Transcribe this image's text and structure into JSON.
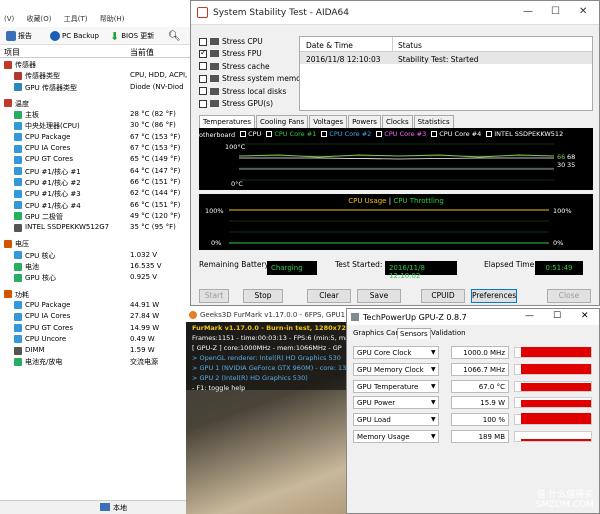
{
  "left": {
    "menu": [
      "(V)",
      "收藏(O)",
      "工具(T)",
      "帮助(H)"
    ],
    "toolbar": {
      "report": "报告",
      "backup": "PC Backup",
      "bios": "BIOS 更新"
    },
    "col_item": "项目",
    "col_value": "当前值",
    "rows": [
      {
        "type": "cat",
        "label": "传感器",
        "value": "",
        "color": "#c0392b",
        "indent": 4
      },
      {
        "type": "item",
        "label": "传感器类型",
        "value": "CPU, HDD, ACPI,",
        "color": "#b03a2e",
        "indent": 14
      },
      {
        "type": "item",
        "label": "GPU 传感器类型",
        "value": "Diode (NV-Diod",
        "color": "#2e86c1",
        "indent": 14
      },
      {
        "type": "gap"
      },
      {
        "type": "cat",
        "label": "温度",
        "value": "",
        "color": "#c0392b",
        "indent": 4
      },
      {
        "type": "item",
        "label": "主板",
        "value": "28 °C (82 °F)",
        "color": "#27ae60",
        "indent": 14
      },
      {
        "type": "item",
        "label": "中央处理器(CPU)",
        "value": "30 °C (86 °F)",
        "color": "#3498db",
        "indent": 14
      },
      {
        "type": "item",
        "label": "CPU Package",
        "value": "67 °C (153 °F)",
        "color": "#3498db",
        "indent": 14
      },
      {
        "type": "item",
        "label": "CPU IA Cores",
        "value": "67 °C (153 °F)",
        "color": "#3498db",
        "indent": 14
      },
      {
        "type": "item",
        "label": "CPU GT Cores",
        "value": "65 °C (149 °F)",
        "color": "#3498db",
        "indent": 14
      },
      {
        "type": "item",
        "label": "CPU #1/核心 #1",
        "value": "64 °C (147 °F)",
        "color": "#3498db",
        "indent": 14
      },
      {
        "type": "item",
        "label": "CPU #1/核心 #2",
        "value": "66 °C (151 °F)",
        "color": "#3498db",
        "indent": 14
      },
      {
        "type": "item",
        "label": "CPU #1/核心 #3",
        "value": "62 °C (144 °F)",
        "color": "#3498db",
        "indent": 14
      },
      {
        "type": "item",
        "label": "CPU #1/核心 #4",
        "value": "66 °C (151 °F)",
        "color": "#3498db",
        "indent": 14
      },
      {
        "type": "item",
        "label": "GPU 二极管",
        "value": "49 °C (120 °F)",
        "color": "#27ae60",
        "indent": 14
      },
      {
        "type": "item",
        "label": "INTEL SSDPEKKW512G7",
        "value": "35 °C (95 °F)",
        "color": "#555555",
        "indent": 14
      },
      {
        "type": "gap"
      },
      {
        "type": "cat",
        "label": "电压",
        "value": "",
        "color": "#d35400",
        "indent": 4
      },
      {
        "type": "item",
        "label": "CPU 核心",
        "value": "1.032 V",
        "color": "#3498db",
        "indent": 14
      },
      {
        "type": "item",
        "label": "电池",
        "value": "16.535 V",
        "color": "#27ae60",
        "indent": 14
      },
      {
        "type": "item",
        "label": "GPU 核心",
        "value": "0.925 V",
        "color": "#27ae60",
        "indent": 14
      },
      {
        "type": "gap"
      },
      {
        "type": "cat",
        "label": "功耗",
        "value": "",
        "color": "#d35400",
        "indent": 4
      },
      {
        "type": "item",
        "label": "CPU Package",
        "value": "44.91 W",
        "color": "#3498db",
        "indent": 14
      },
      {
        "type": "item",
        "label": "CPU IA Cores",
        "value": "27.84 W",
        "color": "#3498db",
        "indent": 14
      },
      {
        "type": "item",
        "label": "CPU GT Cores",
        "value": "14.99 W",
        "color": "#3498db",
        "indent": 14
      },
      {
        "type": "item",
        "label": "CPU Uncore",
        "value": "0.49 W",
        "color": "#3498db",
        "indent": 14
      },
      {
        "type": "item",
        "label": "DIMM",
        "value": "1.59 W",
        "color": "#555555",
        "indent": 14
      },
      {
        "type": "item",
        "label": "电池充/放电",
        "value": "交流电源",
        "color": "#27ae60",
        "indent": 14
      }
    ],
    "status": "本地"
  },
  "stab": {
    "title": "System Stability Test - AIDA64",
    "stress": [
      {
        "label": "Stress CPU",
        "checked": false
      },
      {
        "label": "Stress FPU",
        "checked": true
      },
      {
        "label": "Stress cache",
        "checked": false
      },
      {
        "label": "Stress system memory",
        "checked": false
      },
      {
        "label": "Stress local disks",
        "checked": false
      },
      {
        "label": "Stress GPU(s)",
        "checked": false
      }
    ],
    "ev_col1": "Date & Time",
    "ev_col2": "Status",
    "ev_time": "2016/11/8 12:10:03",
    "ev_status": "Stability Test: Started",
    "tabs": [
      "Temperatures",
      "Cooling Fans",
      "Voltages",
      "Powers",
      "Clocks",
      "Statistics"
    ],
    "legend": [
      {
        "label": "otherboard",
        "color": "#ffffff"
      },
      {
        "label": "CPU",
        "color": "#ffffff"
      },
      {
        "label": "CPU Core #1",
        "color": "#2ecc40"
      },
      {
        "label": "CPU Core #2",
        "color": "#3fa9f5"
      },
      {
        "label": "CPU Core #3",
        "color": "#ff66ff"
      },
      {
        "label": "CPU Core #4",
        "color": "#ffffff"
      },
      {
        "label": "INTEL SSDPEKKW512",
        "color": "#ffffff"
      }
    ],
    "temp_top": "100°C",
    "temp_bot": "0°C",
    "temp_r1": "66",
    "temp_r1b": "68",
    "temp_r2": "30",
    "temp_r2b": "35",
    "usage_title": "CPU Usage",
    "usage_sep": "|",
    "throttle_title": "CPU Throttling",
    "pct100": "100%",
    "pct0": "0%",
    "pct100r": "100%",
    "pct0r": "0%",
    "battery_label": "Remaining Battery:",
    "battery_value": "Charging",
    "started_label": "Test Started:",
    "started_value": "2016/11/8 12:10:02",
    "elapsed_label": "Elapsed Time:",
    "elapsed_value": "0:51:49",
    "buttons": {
      "start": "Start",
      "stop": "Stop",
      "clear": "Clear",
      "save": "Save",
      "cpuid": "CPUID",
      "prefs": "Preferences",
      "close": "Close"
    }
  },
  "fur": {
    "title": "Geeks3D FurMark v1.17.0.0 - 6FPS, GPU1",
    "l1": "FurMark v1.17.0.0 - Burn-in test, 1280x720 (0X",
    "l2": "Frames:1151 - time:00:03:13 - FPS:6 (min:5, max",
    "l3": "[ GPU-Z ] core:1000MHz - mem:1066MHz - GP",
    "l4": "> OpenGL renderer: Intel(R) HD Graphics 530",
    "l5": "> GPU 1 (NVIDIA GeForce GTX 960M) - core: 13",
    "l6": "> GPU 2 (Intel(R) HD Graphics 530)",
    "l7": "- F1: toggle help"
  },
  "gpuz": {
    "title": "TechPowerUp GPU-Z 0.8.7",
    "tabs": [
      "Graphics Card",
      "Sensors",
      "Validation"
    ],
    "rows": [
      {
        "name": "GPU Core Clock",
        "value": "1000.0 MHz",
        "fill": 0.95
      },
      {
        "name": "GPU Memory Clock",
        "value": "1066.7 MHz",
        "fill": 0.95
      },
      {
        "name": "GPU Temperature",
        "value": "67.0 °C",
        "fill": 0.7
      },
      {
        "name": "GPU Power",
        "value": "15.9 W",
        "fill": 0.6
      },
      {
        "name": "GPU Load",
        "value": "100 %",
        "fill": 1.0
      },
      {
        "name": "Memory Usage",
        "value": "189 MB",
        "fill": 0.1
      }
    ]
  },
  "watermark": {
    "line1": "值 什么值得买",
    "line2": "SMZDM.COM"
  }
}
